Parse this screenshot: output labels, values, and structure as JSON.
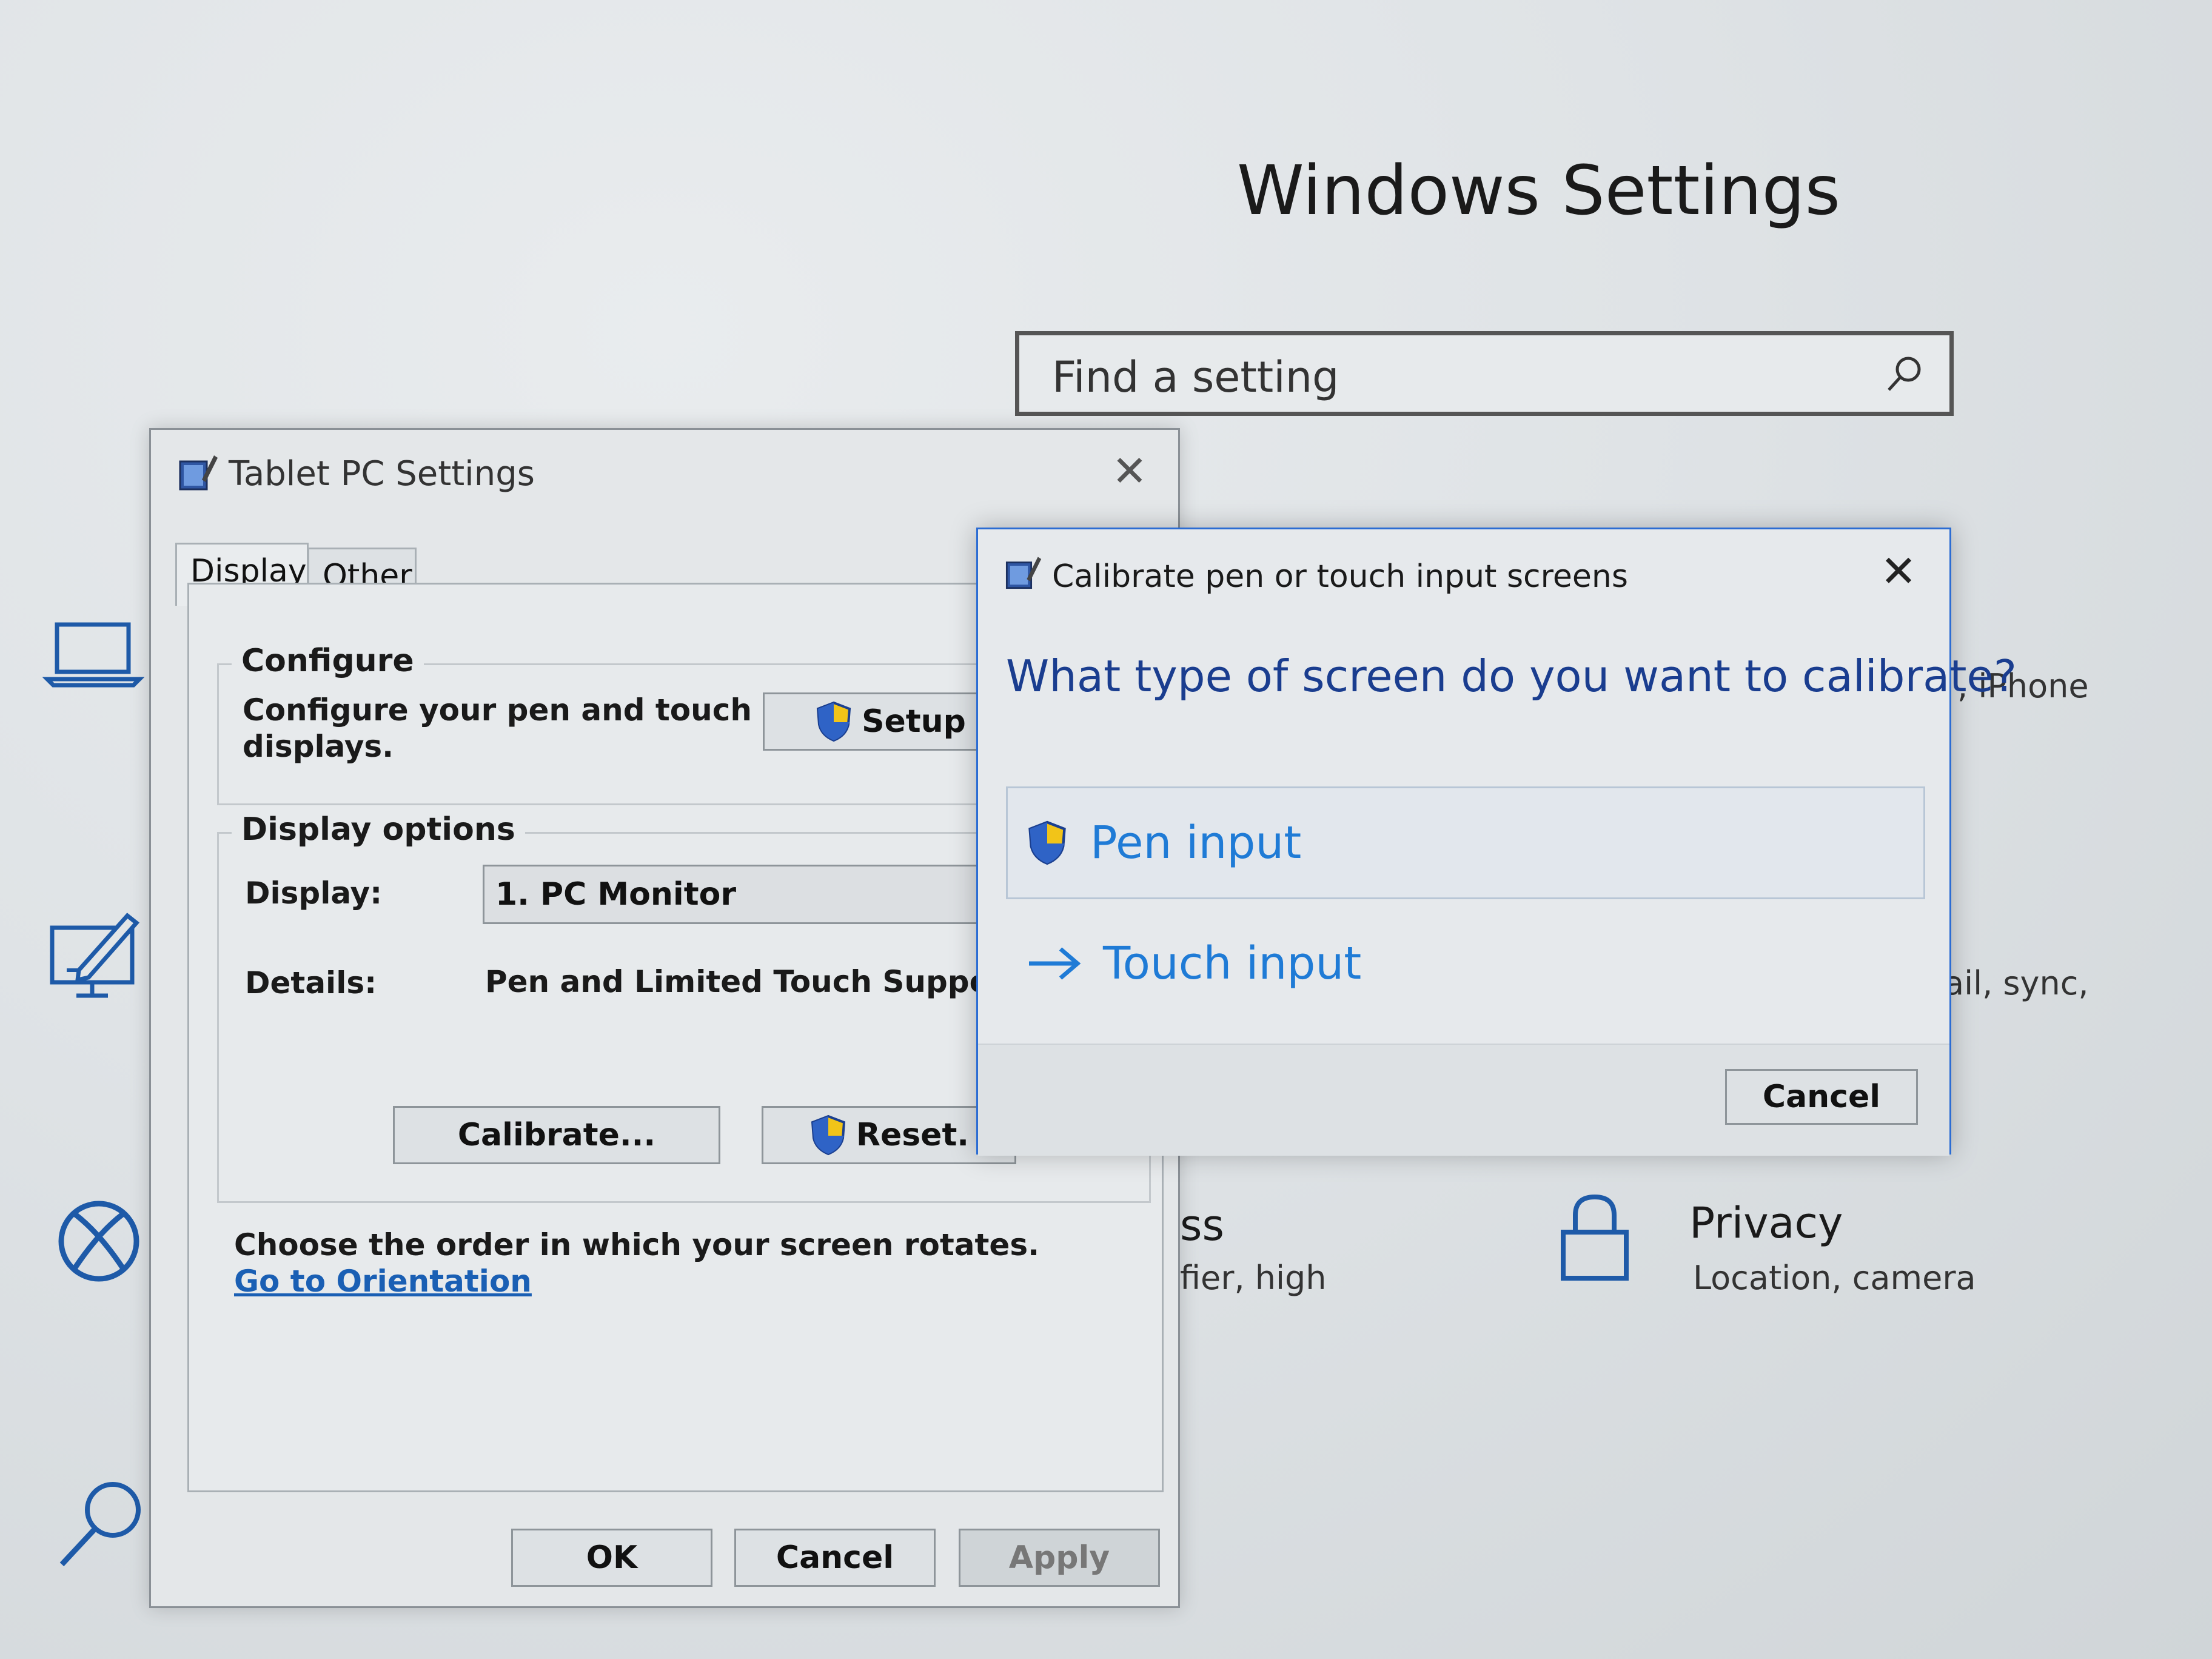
{
  "settings": {
    "title": "Windows Settings",
    "search_placeholder": "Find a setting",
    "tiles": {
      "phone_desc_fragment": ", iPhone",
      "accounts_desc_fragment": "ail, sync,",
      "ease_title_fragment": "ss",
      "ease_desc_fragment": "fier, high",
      "privacy_title": "Privacy",
      "privacy_desc": "Location, camera"
    },
    "sidebar_icons": [
      "laptop-icon",
      "pen-display-icon",
      "xbox-icon",
      "search-icon"
    ]
  },
  "tablet_pc": {
    "title": "Tablet PC Settings",
    "tabs": [
      "Display",
      "Other"
    ],
    "configure": {
      "legend": "Configure",
      "description_line1": "Configure your pen and touch",
      "description_line2": "displays.",
      "setup_button": "Setup"
    },
    "display_options": {
      "legend": "Display options",
      "display_label": "Display:",
      "display_value": "1. PC Monitor",
      "details_label": "Details:",
      "details_value": "Pen and Limited Touch Support",
      "calibrate_button": "Calibrate...",
      "reset_button": "Reset."
    },
    "orientation_text": "Choose the order in which your screen rotates.",
    "orientation_link": "Go to Orientation",
    "buttons": {
      "ok": "OK",
      "cancel": "Cancel",
      "apply": "Apply"
    }
  },
  "calibrate": {
    "title": "Calibrate pen or touch input screens",
    "question": "What type of screen do you want to calibrate?",
    "options": [
      "Pen input",
      "Touch input"
    ],
    "cancel_button": "Cancel"
  },
  "colors": {
    "accent_blue": "#1f7bd6",
    "question_blue": "#1a3d8f",
    "link_blue": "#1a5fb4",
    "sidebar_icon_blue": "#1e5aa8"
  }
}
